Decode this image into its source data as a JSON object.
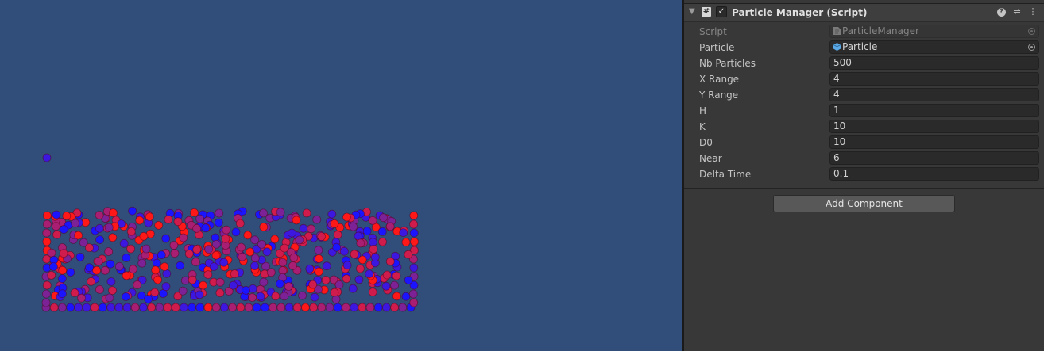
{
  "component": {
    "title": "Particle Manager (Script)",
    "icons": {
      "foldout": "foldout-arrow-icon",
      "script": "script-icon",
      "enabled_toggle": "checkmark-icon",
      "help": "help-icon",
      "presets": "presets-icon",
      "menu": "kebab-menu-icon"
    },
    "properties": [
      {
        "label": "Script",
        "value": "ParticleManager",
        "type": "object",
        "disabled": true,
        "icon": "script-file-icon"
      },
      {
        "label": "Particle",
        "value": "Particle",
        "type": "object",
        "disabled": false,
        "icon": "prefab-icon"
      },
      {
        "label": "Nb Particles",
        "value": "500",
        "type": "number"
      },
      {
        "label": "X Range",
        "value": "4",
        "type": "number"
      },
      {
        "label": "Y Range",
        "value": "4",
        "type": "number"
      },
      {
        "label": "H",
        "value": "1",
        "type": "number"
      },
      {
        "label": "K",
        "value": "10",
        "type": "number"
      },
      {
        "label": "D0",
        "value": "10",
        "type": "number"
      },
      {
        "label": "Near",
        "value": "6",
        "type": "number"
      },
      {
        "label": "Delta Time",
        "value": "0.1",
        "type": "number"
      }
    ]
  },
  "add_component_label": "Add Component",
  "scene": {
    "background": "#314d79",
    "particle_colors": [
      "#ff1818",
      "#d01c4c",
      "#a81e73",
      "#7d2296",
      "#3b17e0",
      "#1a14ff"
    ],
    "particle_count": 500
  }
}
